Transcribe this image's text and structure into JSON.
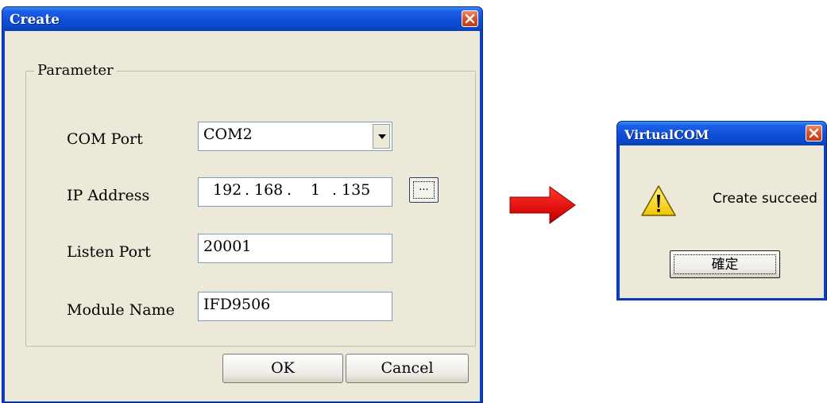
{
  "create_dialog": {
    "title": "Create",
    "group_label": "Parameter",
    "com_port": {
      "label": "COM Port",
      "value": "COM2"
    },
    "ip_address": {
      "label": "IP Address",
      "octets": [
        "192",
        "168",
        "1",
        "135"
      ],
      "browse_label": "..."
    },
    "listen_port": {
      "label": "Listen Port",
      "value": "20001"
    },
    "module_name": {
      "label": "Module Name",
      "value": "IFD9506"
    },
    "ok_label": "OK",
    "cancel_label": "Cancel"
  },
  "message_dialog": {
    "title": "VirtualCOM",
    "message": "Create succeed",
    "ok_label": "確定",
    "icon": "warning-icon"
  },
  "colors": {
    "titlebar": "#0f4fd6",
    "face": "#ece9d8",
    "close_red": "#d9542e",
    "arrow_red": "#e01010"
  }
}
